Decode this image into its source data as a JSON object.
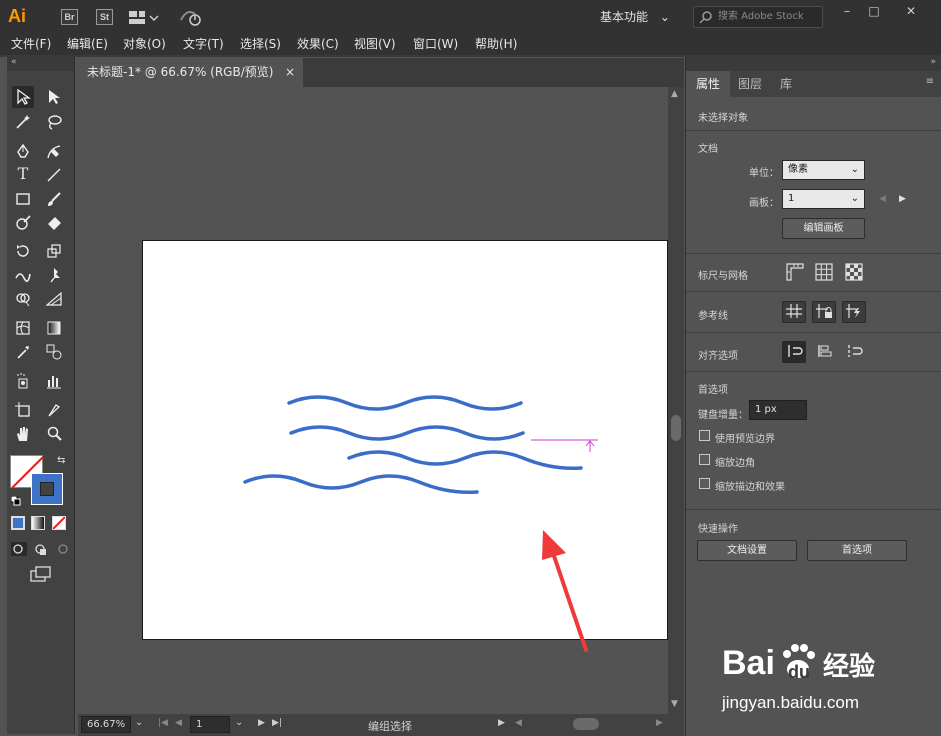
{
  "app": {
    "logo": "Ai",
    "badges": [
      "Br",
      "St"
    ],
    "workspace": "基本功能",
    "search_placeholder": "搜索 Adobe Stock",
    "window_controls": [
      "–",
      "□",
      "✕"
    ]
  },
  "menu": [
    "文件(F)",
    "编辑(E)",
    "对象(O)",
    "文字(T)",
    "选择(S)",
    "效果(C)",
    "视图(V)",
    "窗口(W)",
    "帮助(H)"
  ],
  "document": {
    "tab_title": "未标题-1* @ 66.67% (RGB/预览)",
    "close_label": "×"
  },
  "status": {
    "zoom": "66.67%",
    "artboard_number": "1",
    "tool_status": "编组选择"
  },
  "panel": {
    "tabs": [
      "属性",
      "图层",
      "库"
    ],
    "active_tab": "属性",
    "no_selection": "未选择对象",
    "document_section": "文档",
    "units_label": "单位：",
    "units_value": "像素",
    "artboard_label": "画板：",
    "artboard_value": "1",
    "edit_artboards": "编辑画板",
    "rulers_grids": "标尺与网格",
    "guides": "参考线",
    "align_options": "对齐选项",
    "preferences_section": "首选项",
    "keyboard_increment_label": "键盘增量：",
    "keyboard_increment_value": "1 px",
    "checkboxes": [
      "使用预览边界",
      "缩放边角",
      "缩放描边和效果"
    ],
    "quick_actions": "快速操作",
    "doc_setup_button": "文档设置",
    "preferences_button": "首选项"
  },
  "watermark": {
    "brand": "Bai",
    "brand2": "du",
    "cn": "经验",
    "url": "jingyan.baidu.com"
  },
  "colors": {
    "wave": "#3a6cc8",
    "arrow": "#ef3a3a",
    "accent_logo": "#ff9a00",
    "guide": "#d23ad2"
  }
}
